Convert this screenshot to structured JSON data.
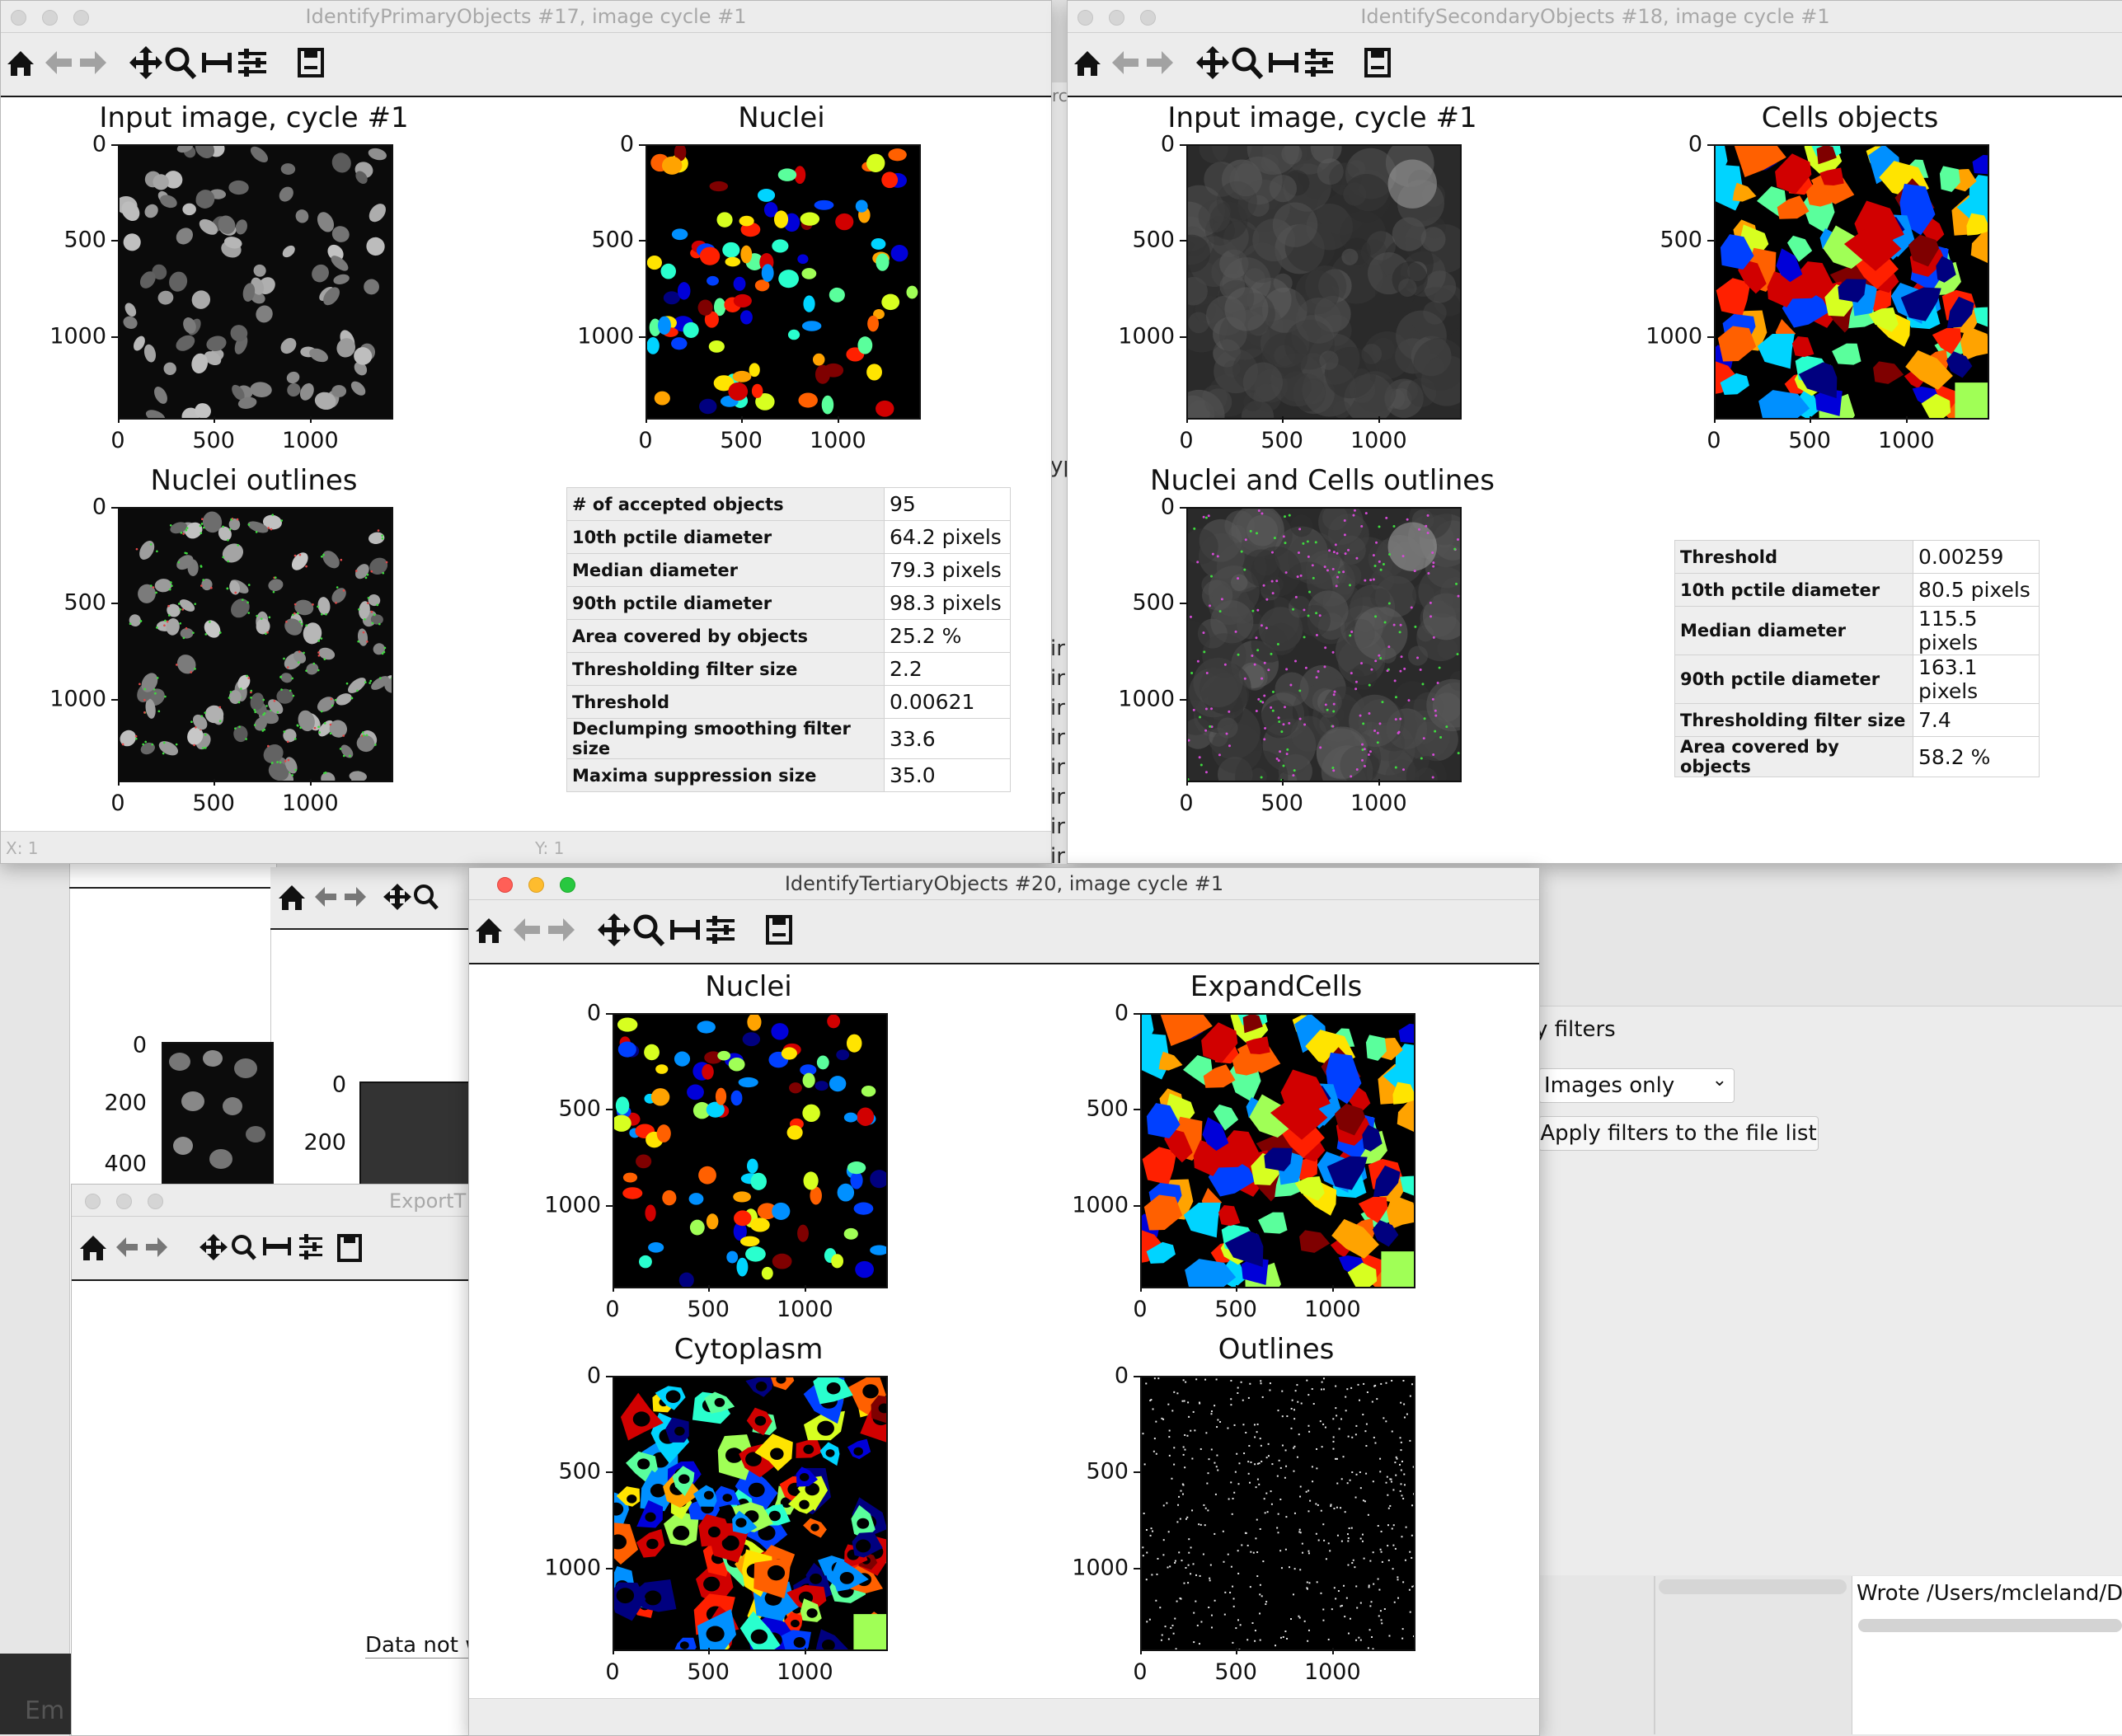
{
  "icons": {
    "home": "home-icon",
    "back": "back-arrow-icon",
    "forward": "forward-arrow-icon",
    "pan": "pan-icon",
    "zoom": "zoom-icon",
    "subplots": "subplots-icon",
    "configure": "configure-icon",
    "save": "save-icon"
  },
  "colors": {
    "magenta_outline": "#d44ad6",
    "green_outline": "#3fdc3f",
    "accent_close": "#ff5f57",
    "accent_min": "#febc2e",
    "accent_max": "#28c840"
  },
  "background": {
    "filters_label": "y filters",
    "select_value": "Images only",
    "apply_button": "Apply filters to the file list",
    "wrote_text": "Wrote /Users/mcleland/Des",
    "data_not_text": "Data not w",
    "emb_text": "Em",
    "export_title": "ExportT",
    "left_ticks_a": [
      "0",
      "200",
      "400"
    ],
    "left_ticks_b": [
      "0",
      "200"
    ],
    "frag_chars": [
      "rc",
      "yp",
      "ir",
      "ir",
      "ir",
      "ir",
      "ir",
      "ir",
      "ir",
      "ir"
    ]
  },
  "win17": {
    "title": "IdentifyPrimaryObjects #17, image cycle #1",
    "panels": [
      {
        "title": "Input image, cycle #1",
        "kind": "grey-nuclei"
      },
      {
        "title": "Nuclei",
        "kind": "labels-nuclei"
      },
      {
        "title": "Nuclei outlines",
        "kind": "outline-nuclei"
      }
    ],
    "ticks_y": [
      "0",
      "500",
      "1000"
    ],
    "ticks_x": [
      "0",
      "500",
      "1000"
    ],
    "stats": [
      {
        "k": "# of accepted objects",
        "v": "95"
      },
      {
        "k": "10th pctile diameter",
        "v": "64.2 pixels"
      },
      {
        "k": "Median diameter",
        "v": "79.3 pixels"
      },
      {
        "k": "90th pctile diameter",
        "v": "98.3 pixels"
      },
      {
        "k": "Area covered by objects",
        "v": "25.2 %"
      },
      {
        "k": "Thresholding filter size",
        "v": "2.2"
      },
      {
        "k": "Threshold",
        "v": "0.00621"
      },
      {
        "k": "Declumping smoothing filter size",
        "v": "33.6"
      },
      {
        "k": "Maxima suppression size",
        "v": "35.0"
      }
    ],
    "status_x": "X: 1",
    "status_y": "Y: 1"
  },
  "win18": {
    "title": "IdentifySecondaryObjects #18, image cycle #1",
    "panels": [
      {
        "title": "Input image, cycle #1",
        "kind": "grey-cells"
      },
      {
        "title": "Cells objects",
        "kind": "labels-cells"
      },
      {
        "title": "Nuclei and Cells outlines",
        "kind": "outline-cells"
      }
    ],
    "ticks_y": [
      "0",
      "500",
      "1000"
    ],
    "ticks_x": [
      "0",
      "500",
      "1000"
    ],
    "stats": [
      {
        "k": "Threshold",
        "v": "0.00259"
      },
      {
        "k": "10th pctile diameter",
        "v": "80.5 pixels"
      },
      {
        "k": "Median diameter",
        "v": "115.5 pixels"
      },
      {
        "k": "90th pctile diameter",
        "v": "163.1 pixels"
      },
      {
        "k": "Thresholding filter size",
        "v": "7.4"
      },
      {
        "k": "Area covered by objects",
        "v": "58.2 %"
      }
    ]
  },
  "win20": {
    "title": "IdentifyTertiaryObjects #20, image cycle #1",
    "panels": [
      {
        "title": "Nuclei",
        "kind": "labels-nuclei"
      },
      {
        "title": "ExpandCells",
        "kind": "labels-cells"
      },
      {
        "title": "Cytoplasm",
        "kind": "cytoplasm"
      },
      {
        "title": "Outlines",
        "kind": "outlines-white"
      }
    ],
    "ticks_y": [
      "0",
      "500",
      "1000"
    ],
    "ticks_x": [
      "0",
      "500",
      "1000"
    ]
  }
}
